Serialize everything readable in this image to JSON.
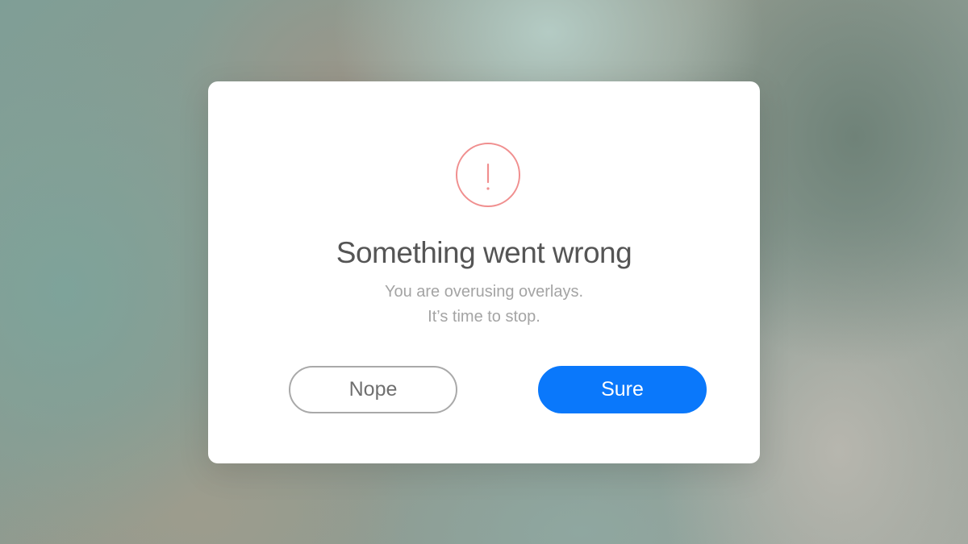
{
  "dialog": {
    "icon": "exclamation-circle-icon",
    "icon_glyph": "!",
    "title": "Something went wrong",
    "message_line1": "You are overusing overlays.",
    "message_line2": "It’s time to stop.",
    "buttons": {
      "nope_label": "Nope",
      "sure_label": "Sure"
    }
  },
  "colors": {
    "accent": "#0a78fb",
    "alert": "#f08f8f",
    "title": "#555555",
    "message": "#a4a4a4",
    "secondary_border": "#a9a9a9"
  }
}
